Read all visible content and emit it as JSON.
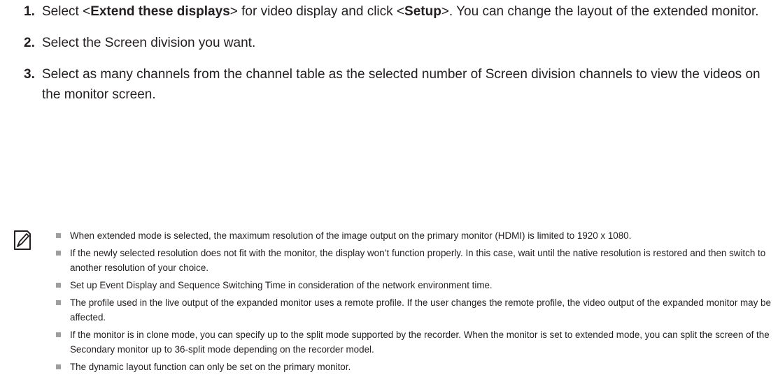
{
  "steps": [
    {
      "number": "1.",
      "t1": "Select <",
      "b1": "Extend these displays",
      "t2": "> for video display and click <",
      "b2": "Setup",
      "t3": ">. You can change the layout of the extended monitor."
    },
    {
      "number": "2.",
      "text": "Select the Screen division you want."
    },
    {
      "number": "3.",
      "text": "Select as many channels from the channel table as the selected number of Screen division channels to view the videos on the monitor screen."
    }
  ],
  "note_icon": "note-pencil-icon",
  "notes": [
    "When extended mode is selected, the maximum resolution of the image output on the primary monitor (HDMI) is limited to 1920 x 1080.",
    "If the newly selected resolution does not fit with the monitor, the display won’t function properly. In this case, wait until the native resolution is restored and then switch to another resolution of your choice.",
    "Set up Event Display and Sequence Switching Time in consideration of the network environment time.",
    "The profile used in the live output of the expanded monitor uses a remote profile. If the user changes the remote profile, the video output of the expanded monitor may be affected.",
    "If the monitor is in clone mode, you can specify up to the split mode supported by the recorder. When the monitor is set to extended mode, you can split the screen of the Secondary monitor up to 36-split mode depending on the recorder model.",
    "The dynamic layout function can only be set on the primary monitor."
  ]
}
